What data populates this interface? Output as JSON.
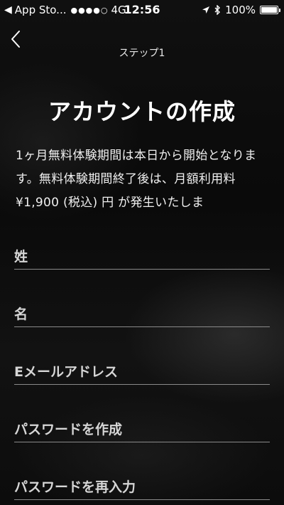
{
  "status_bar": {
    "carrier": "App Sto...",
    "signal_dots": "●●●●○",
    "network": "4G",
    "time": "12:56",
    "battery_percent": "100%"
  },
  "header": {
    "step_label": "ステップ1",
    "title": "アカウントの作成"
  },
  "description": "1ヶ月無料体験期間は本日から開始となります。無料体験期間終了後は、月額利用料 ¥1,900 (税込) 円 が発生いたしま",
  "form": {
    "last_name_placeholder": "姓",
    "first_name_placeholder": "名",
    "email_placeholder": "Eメールアドレス",
    "password_placeholder": "パスワードを作成",
    "password_confirm_placeholder": "パスワードを再入力"
  },
  "icons": {
    "back": "chevron-left-icon",
    "location": "location-arrow-icon",
    "bluetooth": "bluetooth-icon",
    "battery": "battery-icon"
  }
}
